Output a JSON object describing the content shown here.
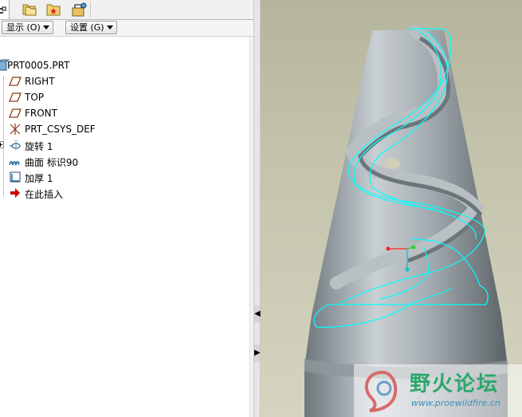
{
  "tabs": [
    {
      "name": "model-tree",
      "icon": "tree-icon",
      "active": true
    },
    {
      "name": "folder-browser",
      "icon": "folders-icon"
    },
    {
      "name": "favorites",
      "icon": "favorites-star-icon"
    },
    {
      "name": "connections",
      "icon": "connections-icon"
    }
  ],
  "toolbar": {
    "display_label": "显示 (O)",
    "settings_label": "设置 (G)"
  },
  "tree": {
    "root": "PRT0005.PRT",
    "items": [
      {
        "label": "RIGHT",
        "icon": "datum-plane-icon"
      },
      {
        "label": "TOP",
        "icon": "datum-plane-icon"
      },
      {
        "label": "FRONT",
        "icon": "datum-plane-icon"
      },
      {
        "label": "PRT_CSYS_DEF",
        "icon": "csys-icon"
      },
      {
        "label": "旋转 1",
        "icon": "revolve-icon"
      },
      {
        "label": "曲面 标识90",
        "icon": "surface-icon"
      },
      {
        "label": "加厚 1",
        "icon": "thicken-icon"
      },
      {
        "label": "在此插入",
        "icon": "insert-here-arrow-icon"
      }
    ]
  },
  "watermark": {
    "title": "野火论坛",
    "url": "www.proewildfire.cn"
  },
  "colors": {
    "background_top": "#b5b59d",
    "model_gray": "#9aa2a6",
    "highlight_edges": "#00ffff",
    "insert_arrow": "#cc0000"
  }
}
